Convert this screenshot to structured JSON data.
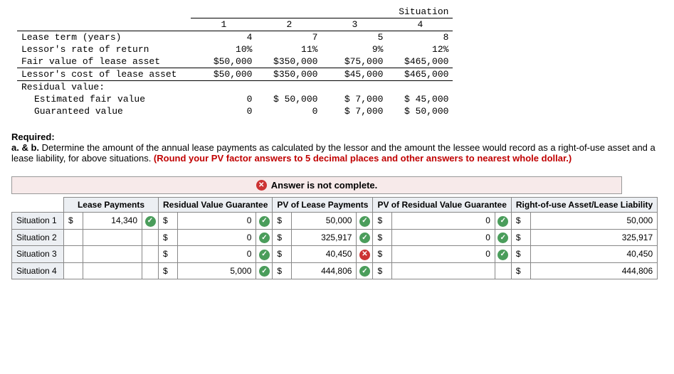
{
  "chart_data": {
    "type": "table",
    "title": "Situation",
    "columns": [
      "1",
      "2",
      "3",
      "4"
    ],
    "rows": [
      {
        "label": "Lease term (years)",
        "values": [
          "4",
          "7",
          "5",
          "8"
        ]
      },
      {
        "label": "Lessor's rate of return",
        "values": [
          "10%",
          "11%",
          "9%",
          "12%"
        ]
      },
      {
        "label": "Fair value of lease asset",
        "values": [
          "$50,000",
          "$350,000",
          "$75,000",
          "$465,000"
        ]
      },
      {
        "label": "Lessor's cost of lease asset",
        "values": [
          "$50,000",
          "$350,000",
          "$45,000",
          "$465,000"
        ]
      },
      {
        "label": "Residual value:",
        "values": [
          "",
          "",
          "",
          ""
        ]
      },
      {
        "label": "Estimated fair value",
        "values": [
          "0",
          "$ 50,000",
          "$ 7,000",
          "$ 45,000"
        ],
        "indent": true
      },
      {
        "label": "Guaranteed value",
        "values": [
          "0",
          "0",
          "$ 7,000",
          "$ 50,000"
        ],
        "indent": true
      }
    ]
  },
  "required": {
    "heading": "Required:",
    "ab": "a. & b.",
    "body": " Determine the amount of the annual lease payments as calculated by the lessor and the amount the lessee would record as a right-of-use asset and a lease liability, for above situations. ",
    "hint": "(Round your PV factor answers to 5 decimal places and other answers to nearest whole dollar.)"
  },
  "status": {
    "text": "Answer is not complete."
  },
  "answer": {
    "headers": [
      "Lease Payments",
      "Residual Value Guarantee",
      "PV of Lease Payments",
      "PV of Residual Value Guarantee",
      "Right-of-use Asset/Lease Liability"
    ],
    "rows": [
      {
        "label": "Situation 1",
        "lease": "14,340",
        "lease_ok": true,
        "rvg": "0",
        "rvg_ok": true,
        "pvl": "50,000",
        "pvl_ok": true,
        "pvr": "0",
        "pvr_ok": true,
        "rou": "50,000"
      },
      {
        "label": "Situation 2",
        "lease": "",
        "lease_ok": null,
        "rvg": "0",
        "rvg_ok": true,
        "pvl": "325,917",
        "pvl_ok": true,
        "pvr": "0",
        "pvr_ok": true,
        "rou": "325,917"
      },
      {
        "label": "Situation 3",
        "lease": "",
        "lease_ok": null,
        "rvg": "0",
        "rvg_ok": true,
        "pvl": "40,450",
        "pvl_ok": false,
        "pvr": "0",
        "pvr_ok": true,
        "rou": "40,450"
      },
      {
        "label": "Situation 4",
        "lease": "",
        "lease_ok": null,
        "rvg": "5,000",
        "rvg_ok": true,
        "pvl": "444,806",
        "pvl_ok": true,
        "pvr": "",
        "pvr_ok": null,
        "rou": "444,806"
      }
    ]
  },
  "sym": {
    "dollar": "$",
    "check": "✓",
    "x": "✕"
  }
}
